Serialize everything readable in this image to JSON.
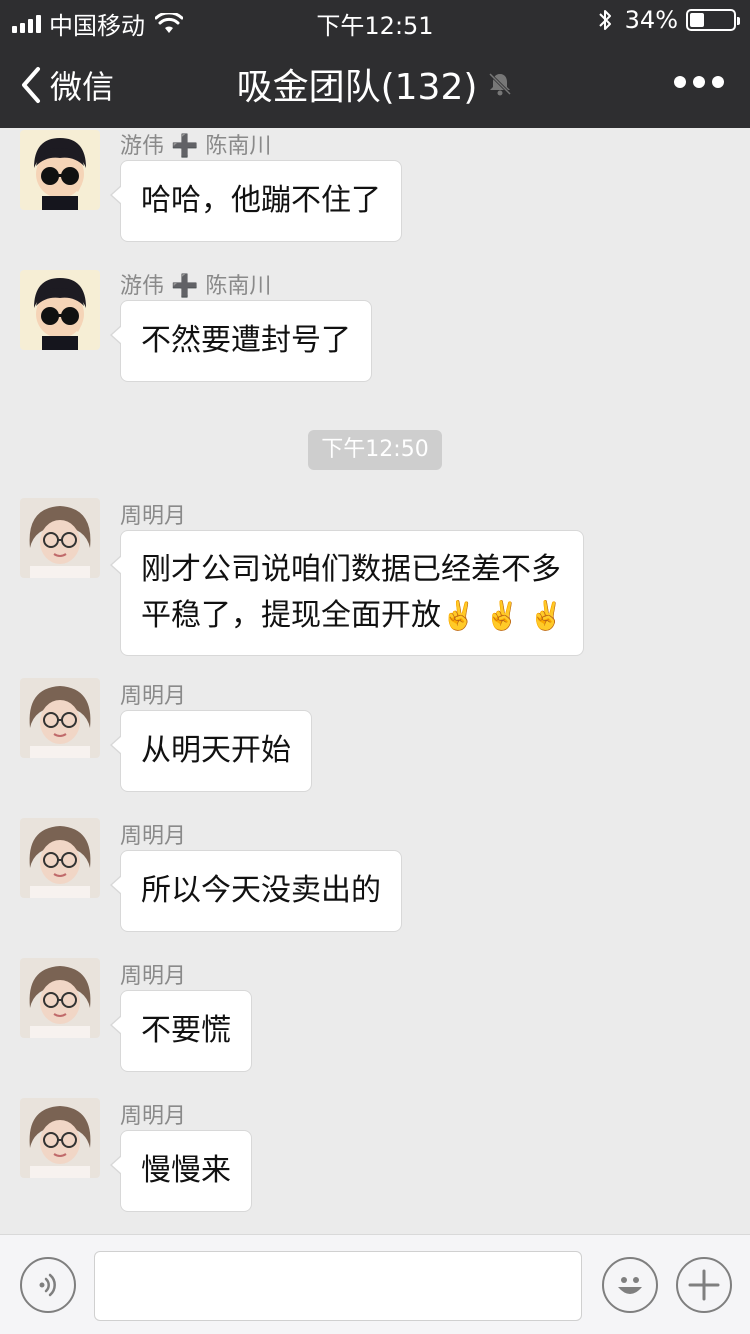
{
  "status_bar": {
    "carrier": "中国移动",
    "time": "下午12:51",
    "battery": "34%",
    "battery_level": 0.34
  },
  "nav": {
    "back_label": "微信",
    "title": "吸金团队(132)"
  },
  "chat": {
    "time_divider": "下午12:50",
    "messages": [
      {
        "sender": "游伟 ➕ 陈南川",
        "text": "哈哈，他蹦不住了"
      },
      {
        "sender": "游伟 ➕ 陈南川",
        "text": "不然要遭封号了"
      },
      {
        "sender": "周明月",
        "line1": "刚才公司说咱们数据已经差不多",
        "line2": "平稳了，提现全面开放",
        "emojis": "✌️ ✌️ ✌️"
      },
      {
        "sender": "周明月",
        "text": "从明天开始"
      },
      {
        "sender": "周明月",
        "text": "所以今天没卖出的"
      },
      {
        "sender": "周明月",
        "text": "不要慌"
      },
      {
        "sender": "周明月",
        "text": "慢慢来"
      }
    ]
  },
  "input_bar": {
    "icons": [
      "voice-icon",
      "emoji-icon",
      "plus-icon"
    ]
  },
  "colors": {
    "header_bg": "#2e2e30",
    "chat_bg": "#ebebeb",
    "bubble_bg": "#ffffff",
    "sender_text": "#8a8a8a"
  }
}
